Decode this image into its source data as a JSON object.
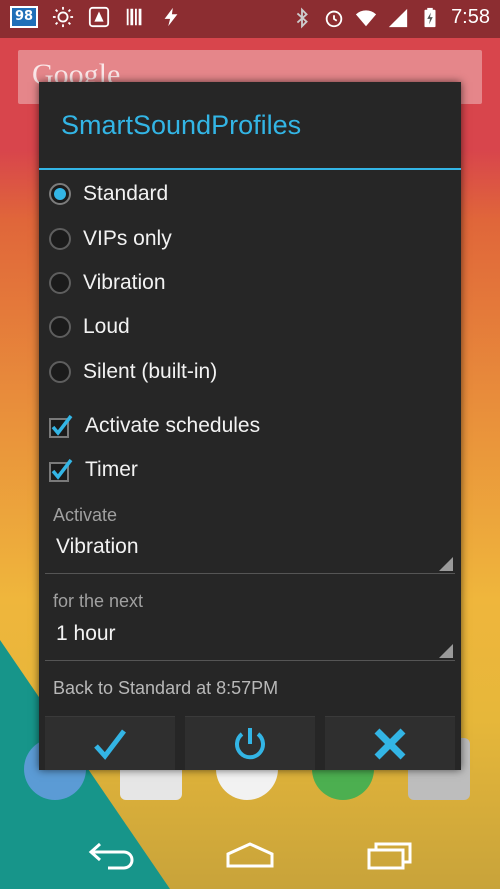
{
  "status": {
    "badge": "98",
    "time": "7:58"
  },
  "home": {
    "search_hint": "Google"
  },
  "dialog": {
    "title": "SmartSoundProfiles",
    "profiles": [
      {
        "label": "Standard",
        "selected": true
      },
      {
        "label": "VIPs only",
        "selected": false
      },
      {
        "label": "Vibration",
        "selected": false
      },
      {
        "label": "Loud",
        "selected": false
      },
      {
        "label": "Silent (built-in)",
        "selected": false
      }
    ],
    "checkboxes": [
      {
        "label": "Activate schedules",
        "checked": true
      },
      {
        "label": "Timer",
        "checked": true
      }
    ],
    "activate": {
      "label": "Activate",
      "value": "Vibration"
    },
    "duration": {
      "label": "for the next",
      "value": "1 hour"
    },
    "back_text": "Back to Standard at 8:57PM",
    "buttons": [
      "check-icon",
      "power-icon",
      "close-icon"
    ],
    "accent": "#33b5e5"
  }
}
